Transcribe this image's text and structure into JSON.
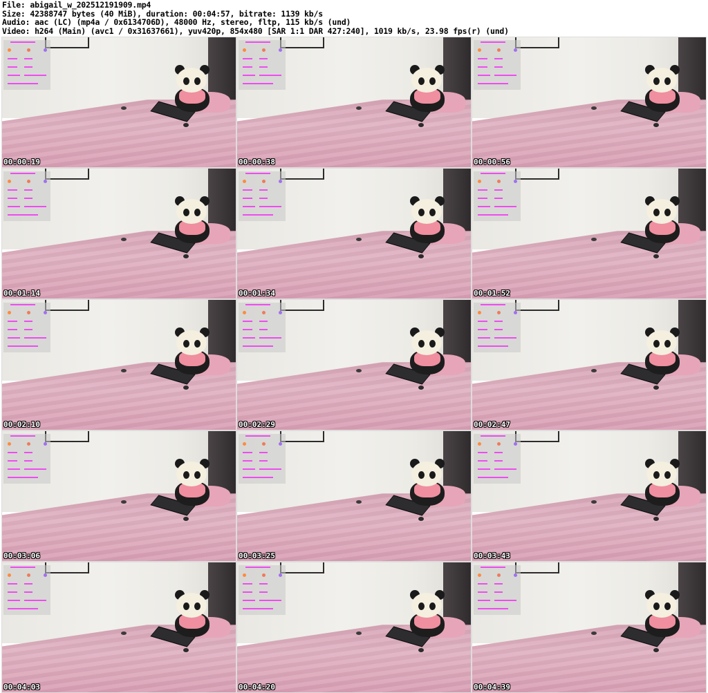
{
  "header": {
    "line1": "File: abigail_w_202512191909.mp4",
    "line2": "Size: 42388747 bytes (40 MiB), duration: 00:04:57, bitrate: 1139 kb/s",
    "line3": "Audio: aac (LC) (mp4a / 0x6134706D), 48000 Hz, stereo, fltp, 115 kb/s (und)",
    "line4": "Video: h264 (Main) (avc1 / 0x31637661), yuv420p, 854x480 [SAR 1:1 DAR 427:240], 1019 kb/s, 23.98 fps(r) (und)"
  },
  "thumbnails": [
    {
      "timestamp": "00:00:19"
    },
    {
      "timestamp": "00:00:38"
    },
    {
      "timestamp": "00:00:56"
    },
    {
      "timestamp": "00:01:14"
    },
    {
      "timestamp": "00:01:34"
    },
    {
      "timestamp": "00:01:52"
    },
    {
      "timestamp": "00:02:10"
    },
    {
      "timestamp": "00:02:29"
    },
    {
      "timestamp": "00:02:47"
    },
    {
      "timestamp": "00:03:06"
    },
    {
      "timestamp": "00:03:25"
    },
    {
      "timestamp": "00:03:43"
    },
    {
      "timestamp": "00:04:03"
    },
    {
      "timestamp": "00:04:20"
    },
    {
      "timestamp": "00:04:39"
    }
  ],
  "colors": {
    "overlay_text": "#ee4cf0",
    "overlay_dot": "#ff8a3c",
    "bedsheet": "#d9a6b8"
  }
}
